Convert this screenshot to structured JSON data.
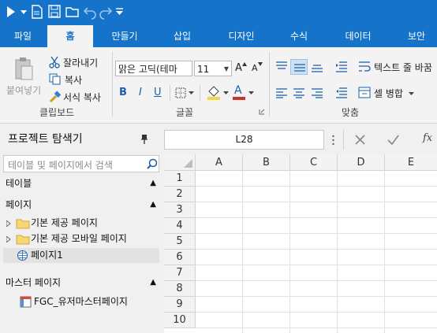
{
  "ribbon_tabs": [
    "파일",
    "홈",
    "만들기",
    "삽입",
    "디자인",
    "수식",
    "데이터",
    "보안"
  ],
  "clipboard": {
    "paste": "붙여넣기",
    "cut": "잘라내기",
    "copy": "복사",
    "format_copy": "서식 복사",
    "group": "클립보드"
  },
  "font": {
    "name": "맑은 고딕(테마",
    "size": "11",
    "group": "글꼴",
    "bold": "B",
    "italic": "I",
    "underline": "U",
    "grow": "A",
    "shrink": "A",
    "color": "A"
  },
  "alignment": {
    "wrap_text": "텍스트 줄 바꿈",
    "merge": "셀 병합",
    "group": "맞춤"
  },
  "explorer": {
    "title": "프로젝트 탐색기",
    "search_placeholder": "테이블 및 페이지에서 검색",
    "sec_tables": "테이블",
    "sec_pages": "페이지",
    "page_items": [
      "기본 제공 페이지",
      "기본 제공 모바일 페이지",
      "페이지1"
    ],
    "sec_master": "마스터 페이지",
    "master_items": [
      "FGC_유저마스터페이지"
    ]
  },
  "formula": {
    "cell_ref": "L28",
    "fx": "fx"
  },
  "grid": {
    "columns": [
      "A",
      "B",
      "C",
      "D",
      "E"
    ],
    "rows": [
      "1",
      "2",
      "3",
      "4",
      "5",
      "6",
      "7",
      "8",
      "9",
      "10"
    ]
  },
  "colors": {
    "accent": "#1574c9",
    "fill_swatch": "#f3d44a",
    "font_color_swatch": "#d0312d"
  }
}
